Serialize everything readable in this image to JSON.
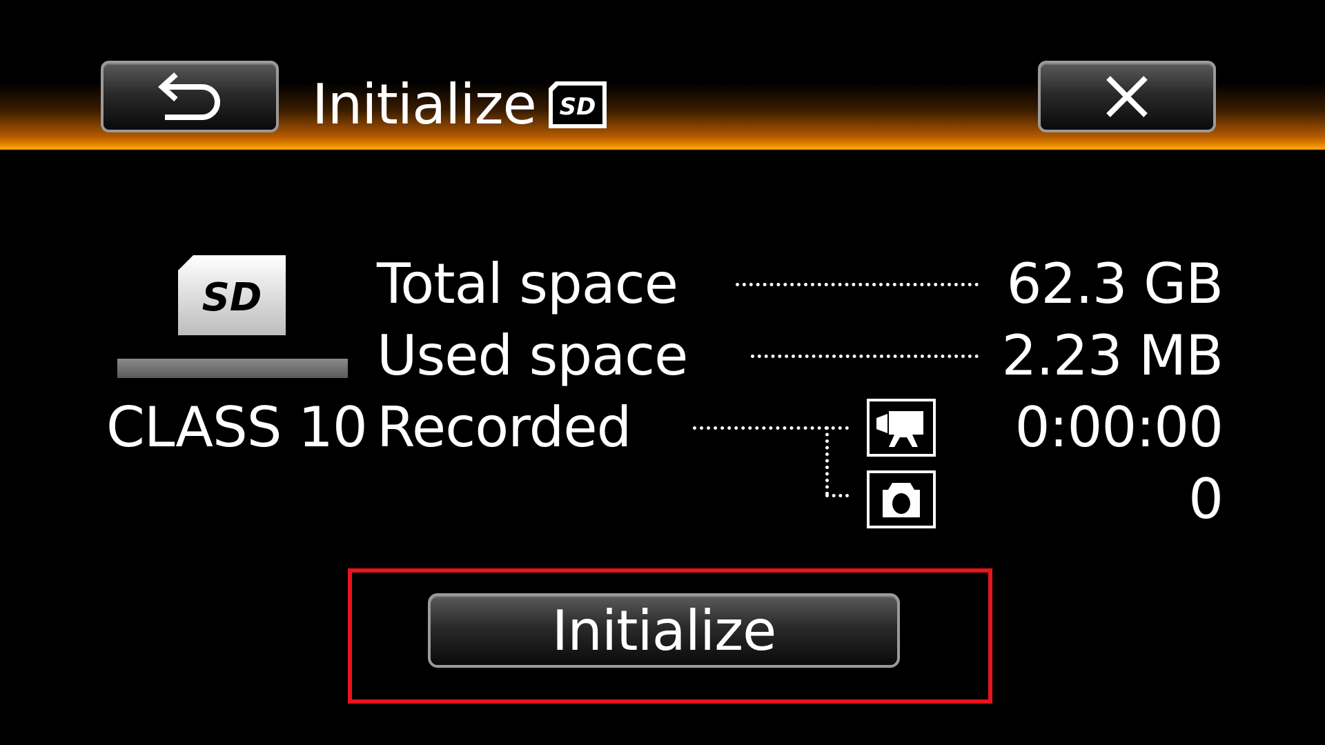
{
  "header": {
    "title": "Initialize",
    "back_icon": "back-arrow-icon",
    "close_icon": "close-icon",
    "media_icon": "sd-card-icon",
    "accent_color": "#f09000"
  },
  "card": {
    "icon": "sd-card-icon",
    "class_label": "CLASS 10"
  },
  "info": {
    "rows": [
      {
        "label": "Total space",
        "value": "62.3 GB"
      },
      {
        "label": "Used space",
        "value": "2.23 MB"
      },
      {
        "label": "Recorded",
        "value": "0:00:00"
      }
    ],
    "movie_icon": "movie-camera-icon",
    "photo_icon": "photo-camera-icon",
    "photo_count": "0"
  },
  "action": {
    "initialize_label": "Initialize",
    "highlight_color": "#e8141c"
  }
}
